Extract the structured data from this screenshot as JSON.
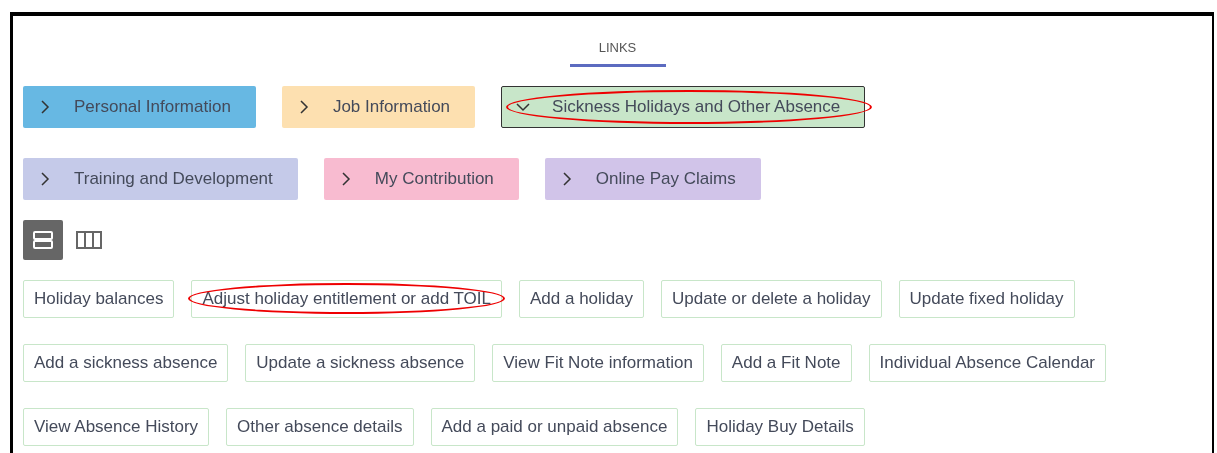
{
  "tabs": [
    {
      "label": "LINKS",
      "selected": true
    }
  ],
  "category_rows": [
    [
      {
        "label": "Personal Information",
        "color": "#67b8e3",
        "expanded": false,
        "circled": false
      },
      {
        "label": "Job Information",
        "color": "#fde0b0",
        "expanded": false,
        "circled": false
      },
      {
        "label": "Sickness Holidays and Other Absence",
        "color": "#c8e6c9",
        "expanded": true,
        "circled": true
      }
    ],
    [
      {
        "label": "Training and Development",
        "color": "#c5cae9",
        "expanded": false,
        "circled": false
      },
      {
        "label": "My Contribution",
        "color": "#f8bbd0",
        "expanded": false,
        "circled": false
      },
      {
        "label": "Online Pay Claims",
        "color": "#d1c4e9",
        "expanded": false,
        "circled": false
      }
    ]
  ],
  "view_toggles": [
    {
      "kind": "rows",
      "selected": true
    },
    {
      "kind": "columns",
      "selected": false
    }
  ],
  "link_rows": [
    [
      {
        "label": "Holiday balances",
        "circled": false
      },
      {
        "label": "Adjust holiday entitlement or add TOIL",
        "circled": true
      },
      {
        "label": "Add a holiday",
        "circled": false
      },
      {
        "label": "Update or delete a holiday",
        "circled": false
      },
      {
        "label": "Update fixed holiday",
        "circled": false
      }
    ],
    [
      {
        "label": "Add a sickness absence",
        "circled": false
      },
      {
        "label": "Update a sickness absence",
        "circled": false
      },
      {
        "label": "View Fit Note information",
        "circled": false
      },
      {
        "label": "Add a Fit Note",
        "circled": false
      },
      {
        "label": "Individual Absence Calendar",
        "circled": false
      }
    ],
    [
      {
        "label": "View Absence History",
        "circled": false
      },
      {
        "label": "Other absence details",
        "circled": false
      },
      {
        "label": "Add a paid or unpaid absence",
        "circled": false
      },
      {
        "label": "Holiday Buy Details",
        "circled": false
      }
    ]
  ]
}
